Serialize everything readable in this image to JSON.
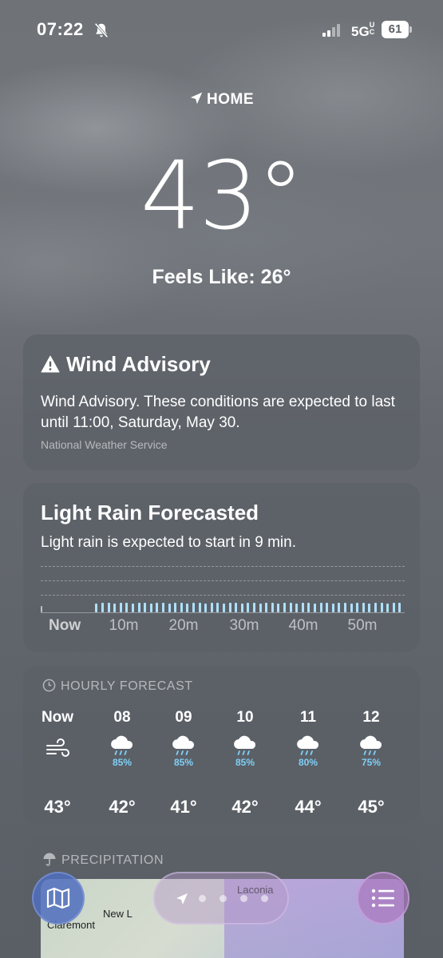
{
  "status_bar": {
    "time": "07:22",
    "network": "5G",
    "network_suffix": "UC",
    "battery": "61",
    "icons": [
      "bell-slash-icon",
      "signal-icon",
      "battery-icon"
    ]
  },
  "header": {
    "location": "HOME",
    "temperature": "43°",
    "feels_like": "Feels Like: 26°"
  },
  "advisory": {
    "title": "Wind Advisory",
    "text": "Wind Advisory. These conditions are expected to last until 11:00, Saturday, May 30.",
    "source": "National Weather Service"
  },
  "rain": {
    "title": "Light Rain Forecasted",
    "text": "Light rain is expected to start in 9 min.",
    "labels": [
      "Now",
      "10m",
      "20m",
      "30m",
      "40m",
      "50m"
    ],
    "start_minute": 9,
    "intensity_level": 0.25,
    "bar_color": "#aee0f9"
  },
  "hourly": {
    "header": "HOURLY FORECAST",
    "hours": [
      {
        "time": "Now",
        "icon": "wind-icon",
        "precip": "",
        "temp": "43°"
      },
      {
        "time": "08",
        "icon": "rain-cloud-icon",
        "precip": "85%",
        "temp": "42°"
      },
      {
        "time": "09",
        "icon": "rain-cloud-icon",
        "precip": "85%",
        "temp": "41°"
      },
      {
        "time": "10",
        "icon": "rain-cloud-icon",
        "precip": "85%",
        "temp": "42°"
      },
      {
        "time": "11",
        "icon": "rain-cloud-icon",
        "precip": "80%",
        "temp": "44°"
      },
      {
        "time": "12",
        "icon": "rain-cloud-icon",
        "precip": "75%",
        "temp": "45°"
      }
    ],
    "precip_color": "#7fcff5"
  },
  "precipitation": {
    "header": "PRECIPITATION",
    "places": [
      "New L",
      "Claremont",
      "Laconia"
    ]
  },
  "toolbar": {
    "page_count": 4,
    "icons": [
      "map-icon",
      "location-arrow-icon",
      "list-icon"
    ]
  }
}
